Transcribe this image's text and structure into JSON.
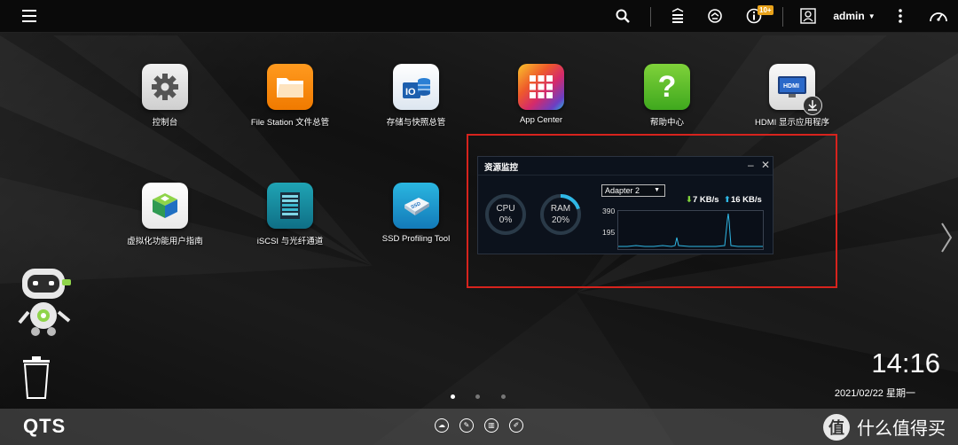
{
  "topbar": {
    "user": "admin",
    "notification_badge": "10+",
    "icons": [
      "menu-icon",
      "search-icon",
      "tasks-icon",
      "sync-icon",
      "info-icon",
      "user-icon",
      "more-icon",
      "dashboard-icon"
    ]
  },
  "apps": [
    {
      "label": "控制台",
      "icon": "gear-icon"
    },
    {
      "label": "File Station 文件总管",
      "icon": "folder-icon"
    },
    {
      "label": "存储与快照总管",
      "icon": "storage-icon"
    },
    {
      "label": "App Center",
      "icon": "app-grid-icon"
    },
    {
      "label": "帮助中心",
      "icon": "help-icon"
    },
    {
      "label": "HDMI 显示应用程序",
      "icon": "hdmi-icon"
    },
    {
      "label": "虚拟化功能用户指南",
      "icon": "virtualization-icon"
    },
    {
      "label": "iSCSI 与光纤通道",
      "icon": "iscsi-icon"
    },
    {
      "label": "SSD Profiling Tool",
      "icon": "ssd-icon"
    }
  ],
  "resource_monitor": {
    "title": "资源监控",
    "cpu_label": "CPU",
    "cpu_value": "0%",
    "cpu_percent": 0,
    "ram_label": "RAM",
    "ram_value": "20%",
    "ram_percent": 20,
    "adapter": "Adapter 2",
    "download": "7 KB/s",
    "upload": "16 KB/s",
    "y_ticks": [
      "390",
      "195"
    ],
    "accent": "#2fb8e6"
  },
  "clock": {
    "time": "14:16",
    "date": "2021/02/22 星期一"
  },
  "page_dots": 3,
  "dock": {
    "logo": "QTS"
  },
  "watermark": {
    "logo_char": "值",
    "text": "什么值得买"
  }
}
